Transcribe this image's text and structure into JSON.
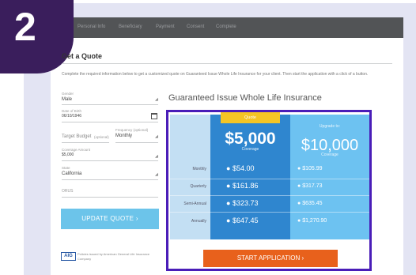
{
  "step_badge": "2",
  "nav": {
    "items": [
      "Personal Info",
      "Beneficiary",
      "Payment",
      "Consent",
      "Complete"
    ]
  },
  "form": {
    "title": "Get a Quote",
    "intro": "Complete the required information below to get a customized quote on Guaranteed Issue Whole Life Insurance for your client. Then start the application with a click of a button.",
    "gender": {
      "label": "Gender",
      "value": "Male"
    },
    "dob": {
      "label": "Date of Birth",
      "value": "06/10/1946"
    },
    "target_budget": {
      "label": "Target Budget",
      "hint": "(optional)"
    },
    "frequency": {
      "label": "Frequency (optional)",
      "value": "Monthly"
    },
    "coverage": {
      "label": "Coverage Amount",
      "value": "$5,000"
    },
    "state": {
      "label": "State",
      "value": "California"
    },
    "orus_label": "ORUS",
    "update_button": "UPDATE QUOTE ›",
    "aig_logo": "AIG",
    "aig_text": "Policies issued by American General Life Insurance Company"
  },
  "quote": {
    "title": "Guaranteed Issue Whole Life Insurance",
    "tab_label": "Quote",
    "amount": "$5,000",
    "coverage_label": "Coverage",
    "upgrade_label": "Upgrade to:",
    "upgrade_amount": "$10,000",
    "upgrade_coverage_label": "Coverage",
    "rows": [
      {
        "label": "Monthly",
        "price": "$54.00",
        "upgrade_price": "$105.99"
      },
      {
        "label": "Quarterly",
        "price": "$161.86",
        "upgrade_price": "$317.73"
      },
      {
        "label": "Semi-Annual",
        "price": "$323.73",
        "upgrade_price": "$635.45"
      },
      {
        "label": "Annually",
        "price": "$647.45",
        "upgrade_price": "$1,270.90"
      }
    ],
    "start_button": "START APPLICATION ›"
  },
  "colors": {
    "badge": "#3a1e5c",
    "highlight_border": "#4a1db8",
    "quote_column": "#2f86cf",
    "upgrade_column": "#6dc2f1",
    "tab": "#f4c525",
    "start_button": "#e8611c",
    "update_button": "#6cc4ea"
  }
}
